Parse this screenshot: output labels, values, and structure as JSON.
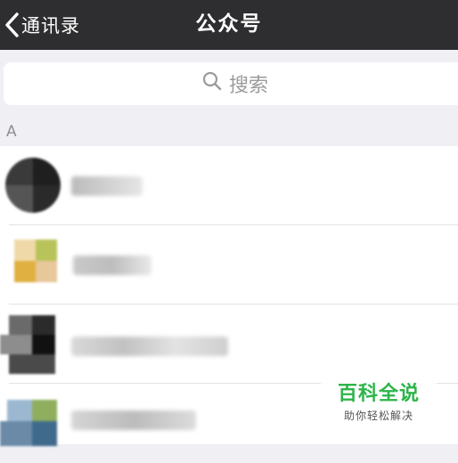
{
  "navbar": {
    "back_label": "通讯录",
    "title": "公众号"
  },
  "search": {
    "placeholder": "搜索"
  },
  "section": {
    "letter": "A"
  },
  "accounts": [
    {
      "name": "",
      "avatar_colors": [
        "#2b2b2b",
        "#4a4a4a",
        "#1e1e1e",
        "#6b6b6b"
      ]
    },
    {
      "name": "",
      "avatar_colors": [
        "#e0b040",
        "#b8c45a",
        "#f0d9a8",
        "#e8c79a"
      ]
    },
    {
      "name": "",
      "avatar_colors": [
        "#3a3a3a",
        "#5c5c5c",
        "#111111",
        "#8a8a8a"
      ]
    },
    {
      "name": "",
      "avatar_colors": [
        "#6a8aa8",
        "#8fae5e",
        "#3f6a8c",
        "#9bb8d0"
      ]
    }
  ],
  "watermark": {
    "main": "百科全说",
    "sub": "助你轻松解决"
  },
  "colors": {
    "navbar_bg": "#2e2e30",
    "background": "#efeff4",
    "watermark_green": "#2db44a"
  }
}
